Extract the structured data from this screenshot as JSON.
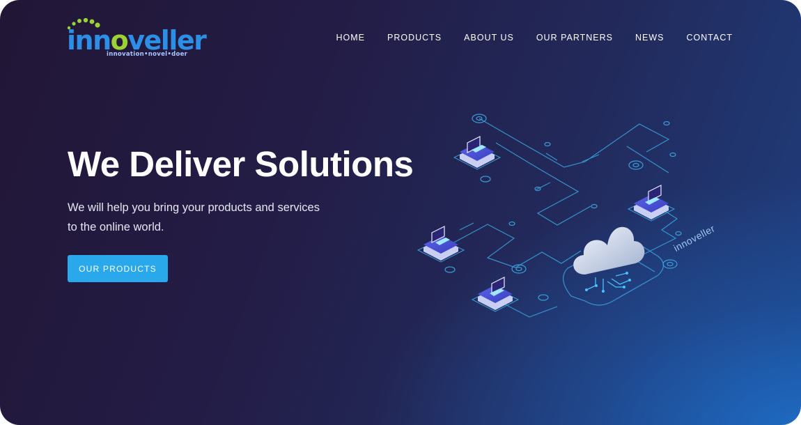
{
  "brand": {
    "name": "innoveller",
    "name_prefix": "inn",
    "name_accent": "o",
    "name_suffix": "veller",
    "tagline": "innovation•novel•doer",
    "colors": {
      "primary": "#2d8ee6",
      "accent": "#9cd334"
    }
  },
  "nav": {
    "items": [
      {
        "label": "HOME"
      },
      {
        "label": "PRODUCTS"
      },
      {
        "label": "ABOUT US"
      },
      {
        "label": "OUR PARTNERS"
      },
      {
        "label": "NEWS"
      },
      {
        "label": "CONTACT"
      }
    ]
  },
  "hero": {
    "title": "We Deliver Solutions",
    "line1": "We will help you bring your products and services",
    "line2": "to the online world.",
    "cta_label": "OUR PRODUCTS"
  },
  "illustration": {
    "brand_text": "innoveller",
    "icons": [
      "cloud-icon",
      "laptop-icon"
    ],
    "colors": {
      "circuit": "#3a9fd8",
      "cloud": "#d9e2f2",
      "cta": "#2aa8ec"
    }
  }
}
